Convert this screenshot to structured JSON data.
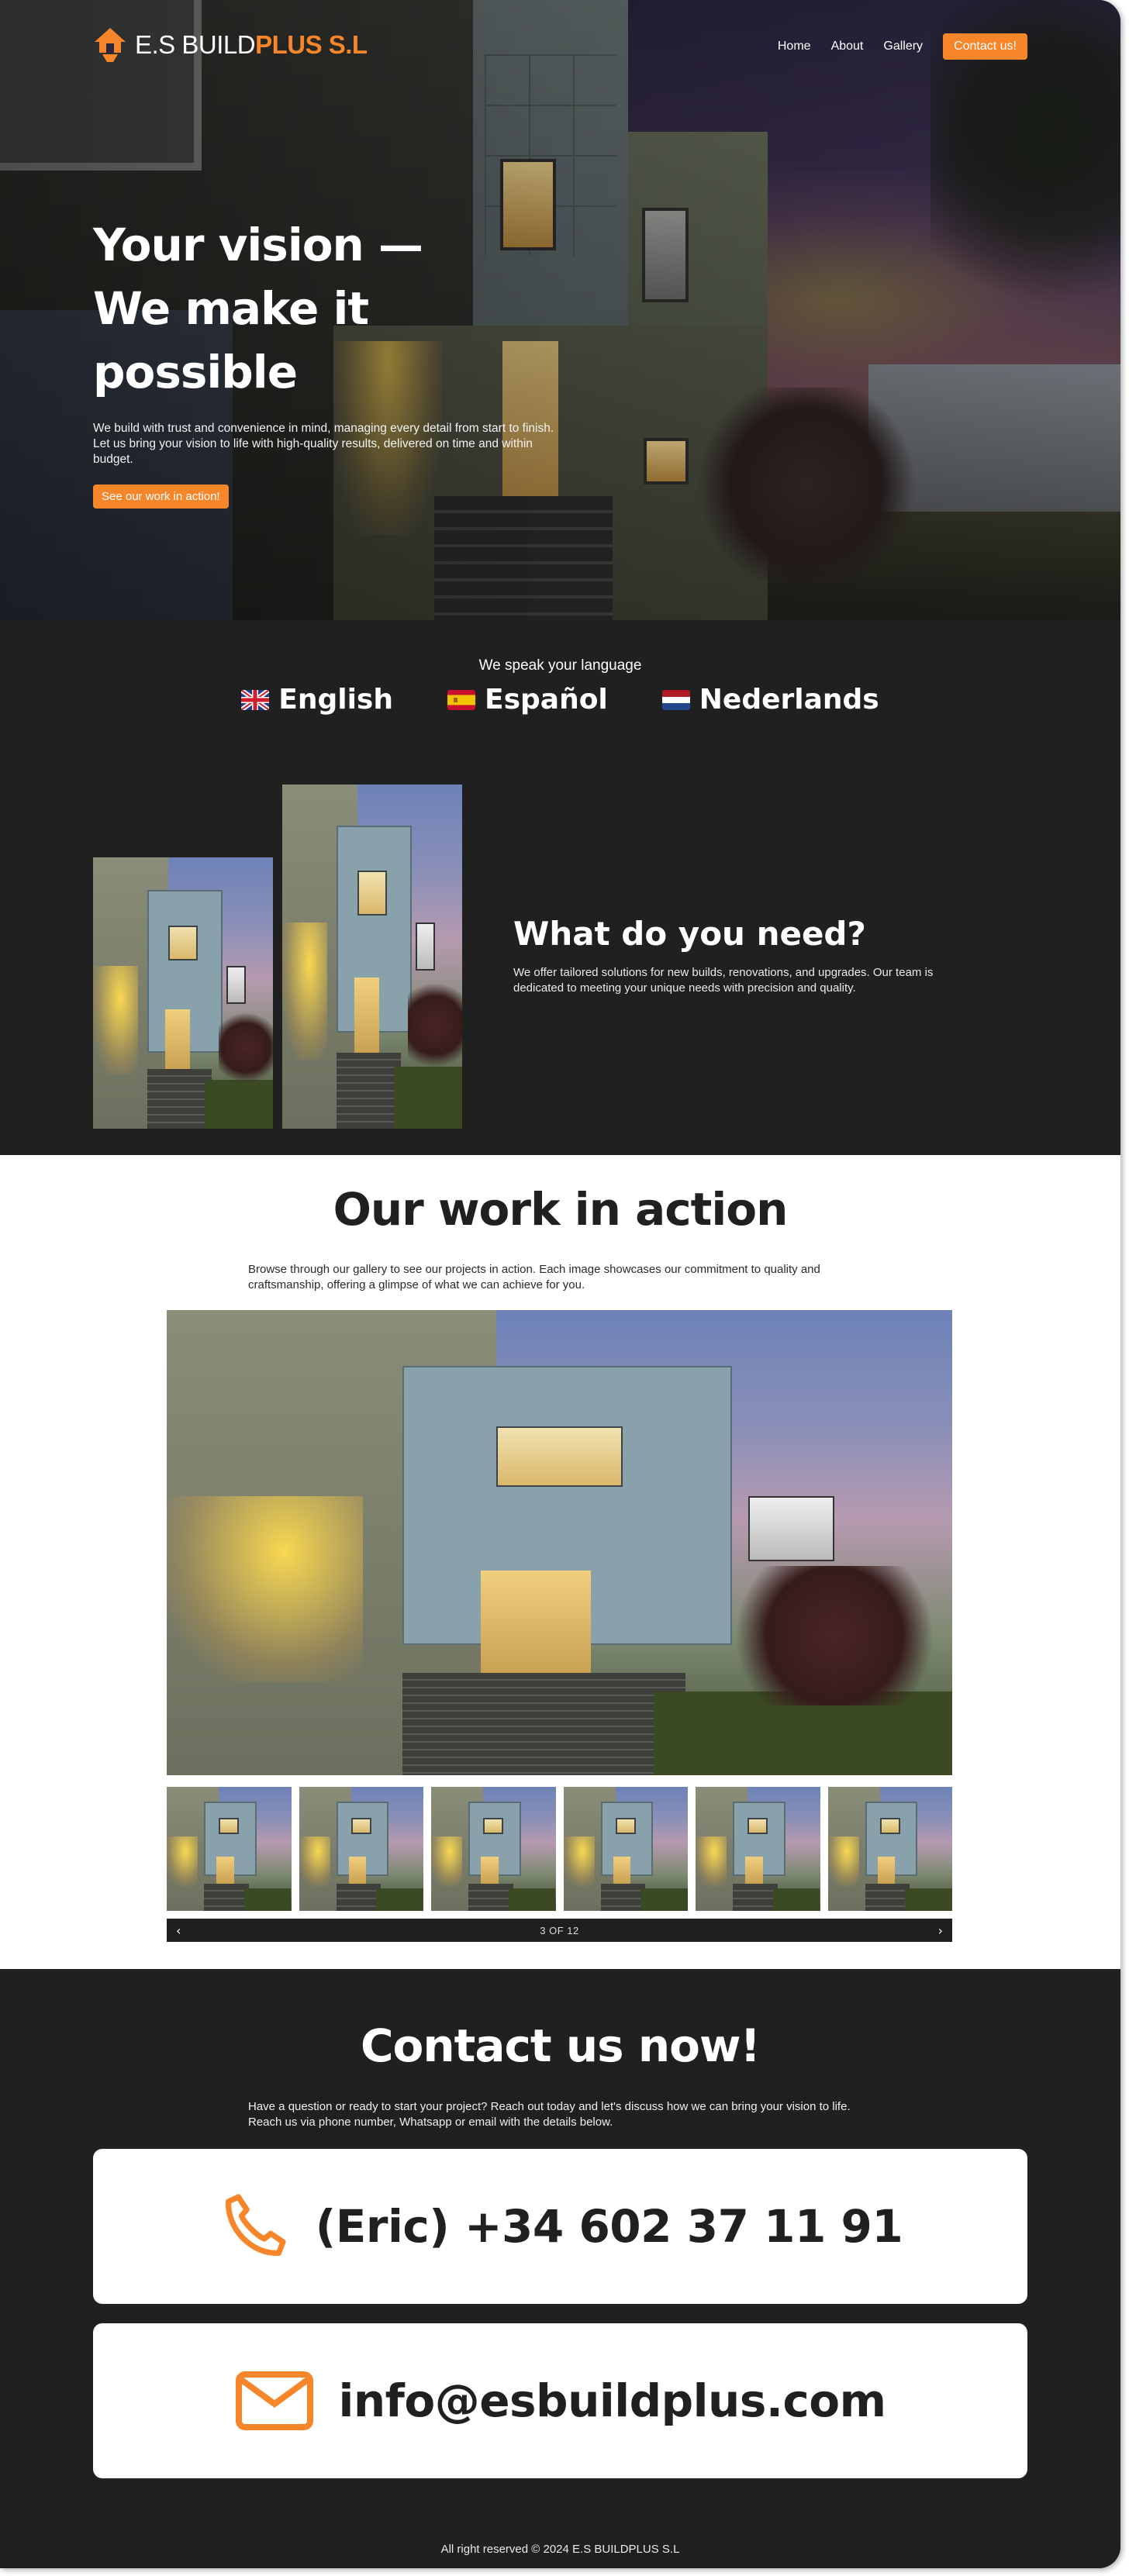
{
  "brand": {
    "name_white": "E.S BUILD",
    "name_orange": "PLUS S.L",
    "accent_color": "#f7862a",
    "dark_color": "#202020"
  },
  "nav": {
    "links": [
      "Home",
      "About",
      "Gallery"
    ],
    "cta": "Contact us!"
  },
  "hero": {
    "title_line1": "Your vision —",
    "title_line2": "We make it possible",
    "paragraph": "We build with trust and convenience in mind, managing every detail from start to finish. Let us bring your vision to life with high-quality results, delivered on time and within budget.",
    "button": "See our work in action!"
  },
  "languages": {
    "title": "We speak your language",
    "items": [
      {
        "name": "English",
        "flag": "uk-flag-icon"
      },
      {
        "name": "Español",
        "flag": "spain-flag-icon"
      },
      {
        "name": "Nederlands",
        "flag": "netherlands-flag-icon"
      }
    ]
  },
  "need": {
    "title": "What do you need?",
    "paragraph": "We offer tailored solutions for new builds, renovations, and upgrades. Our team is dedicated to meeting your unique needs with precision and quality."
  },
  "gallery": {
    "title": "Our work in action",
    "paragraph": "Browse through our gallery to see our projects in action. Each image showcases our commitment to quality and craftsmanship, offering a glimpse of what we can achieve for you.",
    "pager_label": "3 OF 12",
    "prev_icon": "chevron-left-icon",
    "next_icon": "chevron-right-icon"
  },
  "contact": {
    "title": "Contact us now!",
    "paragraph": "Have a question or ready to start your project? Reach out today and let's discuss how we can bring your vision to life. Reach us via phone number, Whatsapp or email with the details below.",
    "phone": "(Eric) +34 602 37 11 91",
    "email": "info@esbuildplus.com",
    "phone_icon": "phone-icon",
    "email_icon": "mail-icon"
  },
  "footer": {
    "text": "All right reserved © 2024 E.S BUILDPLUS S.L"
  }
}
